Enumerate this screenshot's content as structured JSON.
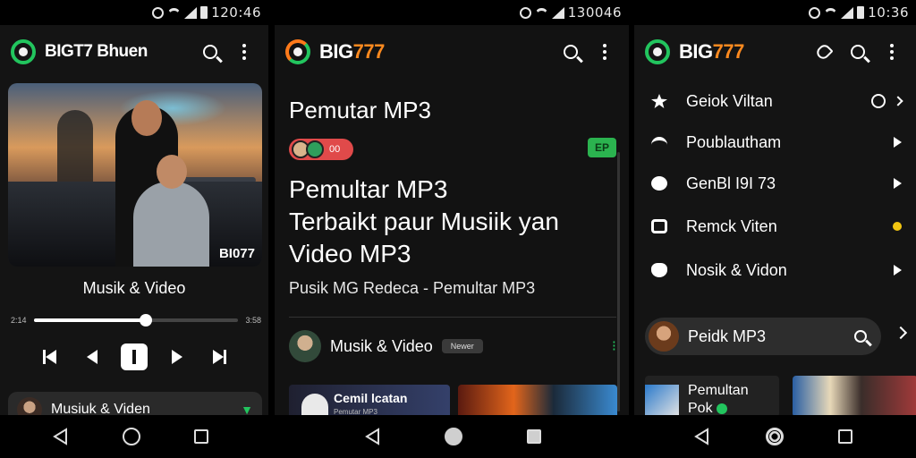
{
  "screens": [
    {
      "status_time": "120:46",
      "brand": "BIGT7 Bhuen",
      "hero_watermark": "BI077",
      "now_playing": "Musik & Video",
      "seek": {
        "elapsed": "2:14",
        "total": "3:58",
        "progress": 0.55
      },
      "mini_player_title": "Musiuk & Viden",
      "icons": [
        "search-icon",
        "more-vert-icon",
        "skip-previous-icon",
        "rewind-icon",
        "play-pause-icon",
        "forward-icon",
        "skip-next-icon"
      ]
    },
    {
      "status_time": "130046",
      "brand_prefix": "BIG",
      "brand_accent": "777",
      "page_title": "Pemutar MP3",
      "chip_text": "00",
      "badge_text": "EP",
      "headline_lines": [
        "Pemultar MP3",
        "Terbaikt paur Musiik yan",
        "Video MP3"
      ],
      "subline": "Pusik MG Redeca - Pemultar MP3",
      "row_title": "Musik & Video",
      "row_pill": "Newer",
      "card_title": "Cemil lcatan",
      "card_sub": "Pemutar MP3"
    },
    {
      "status_time": "10:36",
      "brand_prefix": "BIG",
      "brand_accent": "777",
      "menu": [
        {
          "label": "Geiok Viltan",
          "icon": "star-icon",
          "right": "ring-chevron"
        },
        {
          "label": "Poublautham",
          "icon": "wifi-icon",
          "right": "chevron"
        },
        {
          "label": "GenBl I9I 73",
          "icon": "clover-icon",
          "right": "chevron"
        },
        {
          "label": "Remck Viten",
          "icon": "box-icon",
          "right": "yellow-dot"
        },
        {
          "label": "Nosik & Vidon",
          "icon": "mask-icon",
          "right": "chevron"
        }
      ],
      "search_label": "Peidk MP3",
      "card_title": "Pemultan",
      "card_sub": "Pok"
    }
  ],
  "colors": {
    "accent_green": "#22c55e",
    "brand_orange": "#ff8a1f",
    "chip_red": "#e04a4a",
    "background": "#141414"
  }
}
